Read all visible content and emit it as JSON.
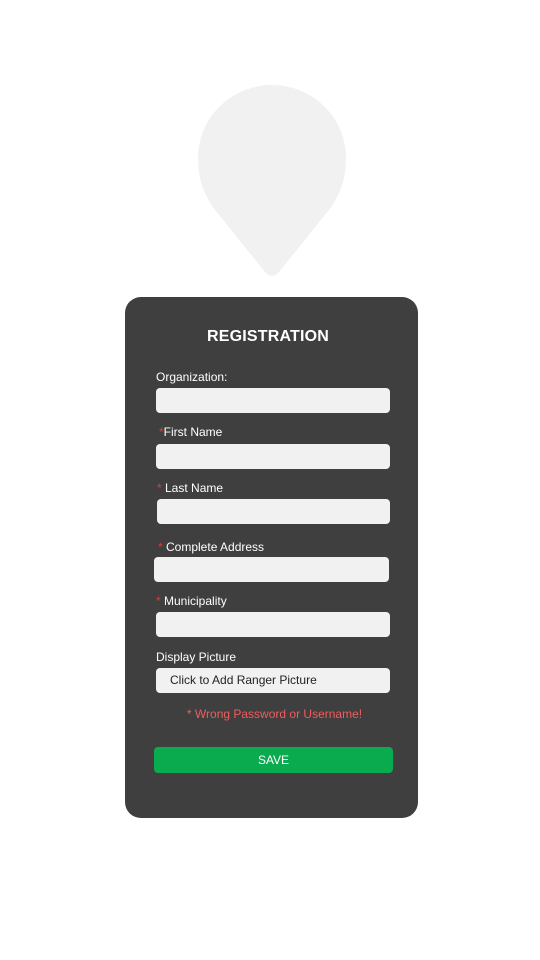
{
  "logo": {
    "icon": "map-pin-icon",
    "color": "#f1f1f1"
  },
  "form": {
    "title": "REGISTRATION",
    "fields": [
      {
        "label": "Organization:",
        "required_mark": "",
        "value": "",
        "placeholder": ""
      },
      {
        "label": "First Name",
        "required_mark": "*",
        "value": "",
        "placeholder": ""
      },
      {
        "label": " Last Name",
        "required_mark": "*",
        "value": "",
        "placeholder": ""
      },
      {
        "label": " Complete Address",
        "required_mark": "*",
        "value": "",
        "placeholder": ""
      },
      {
        "label": " Municipality",
        "required_mark": "*",
        "value": "",
        "placeholder": ""
      }
    ],
    "display_picture": {
      "label": "Display Picture",
      "button_label": "Click to Add Ranger Picture"
    },
    "error_message": "* Wrong Password or Username!",
    "save_label": "SAVE"
  },
  "colors": {
    "card": "#3f3f3f",
    "input": "#f1f1f1",
    "required": "#e53935",
    "error": "#f25c5c",
    "save": "#0aaa4f"
  }
}
